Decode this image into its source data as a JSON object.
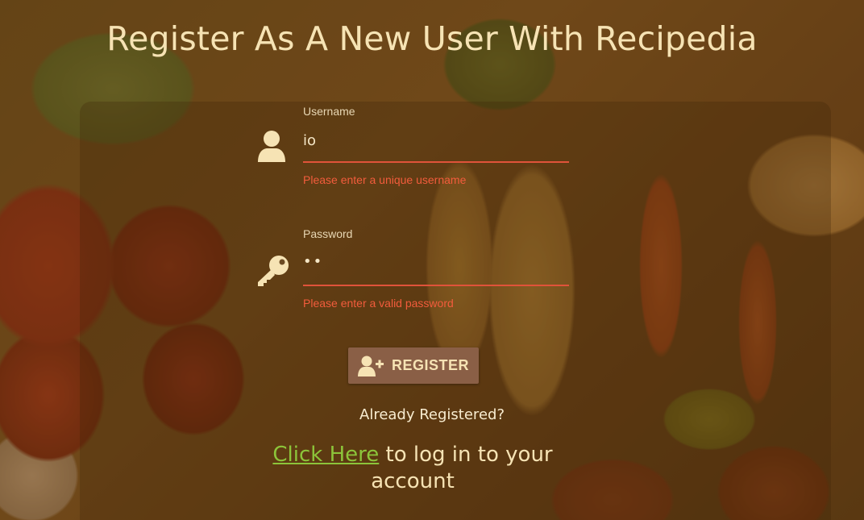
{
  "page": {
    "title": "Register As A New User With Recipedia"
  },
  "form": {
    "username": {
      "label": "Username",
      "value": "io",
      "error": "Please enter a unique username",
      "icon": "user-icon"
    },
    "password": {
      "label": "Password",
      "value": "••",
      "error": "Please enter a valid password",
      "icon": "key-icon"
    },
    "register_button": {
      "label": "REGISTER",
      "icon": "user-plus-icon"
    }
  },
  "login_prompt": {
    "question": "Already Registered?",
    "link_text": "Click Here",
    "suffix": " to log in to your account"
  },
  "colors": {
    "title": "#f6e3b4",
    "error": "#f25c3c",
    "underline": "#e0533a",
    "button_bg": "#8a5f46",
    "link": "#8cc43a"
  }
}
